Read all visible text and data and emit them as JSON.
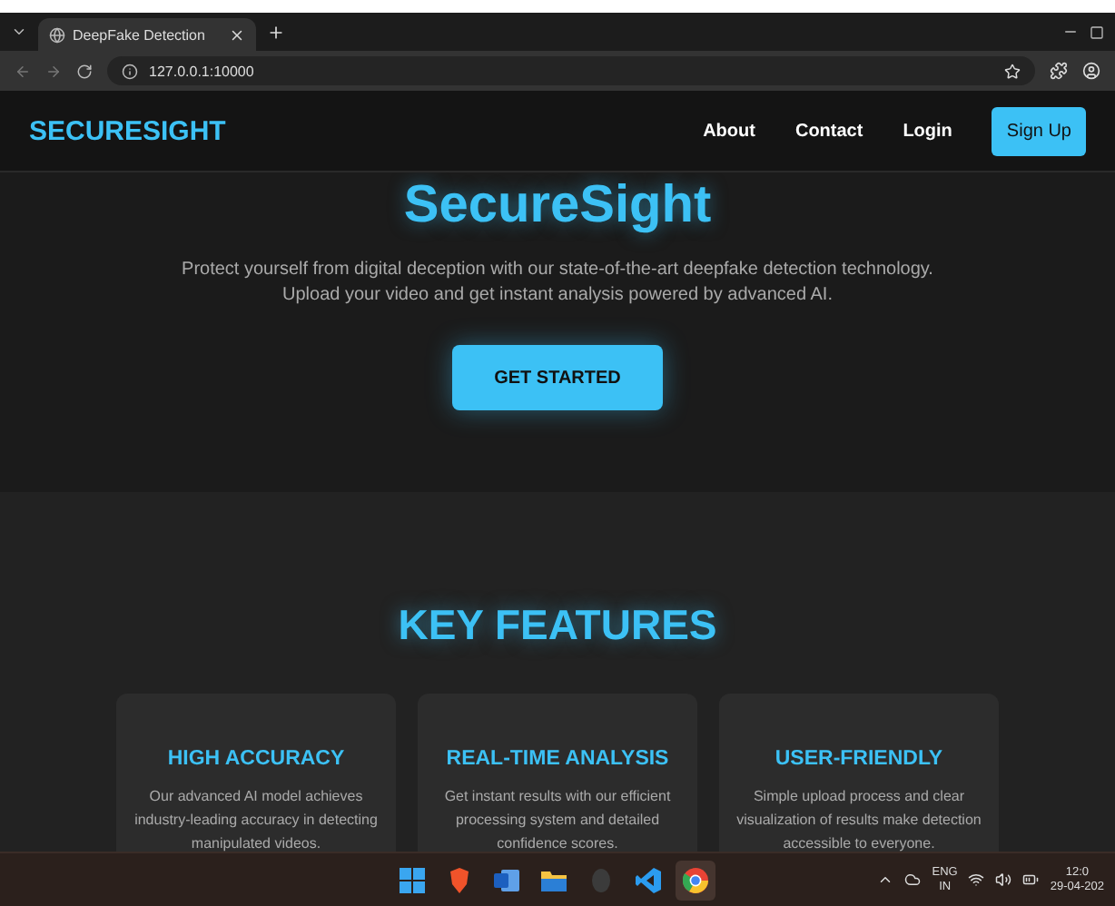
{
  "browser": {
    "tab": {
      "title": "DeepFake Detection",
      "selected": true
    },
    "url": "127.0.0.1:10000"
  },
  "navbar": {
    "brand": "SECURESIGHT",
    "links": [
      "About",
      "Contact",
      "Login"
    ],
    "cta": "Sign Up"
  },
  "hero": {
    "title": "SecureSight",
    "description": "Protect yourself from digital deception with our state-of-the-art deepfake detection technology. Upload your video and get instant analysis powered by advanced AI.",
    "button": "GET STARTED"
  },
  "features": {
    "heading": "KEY FEATURES",
    "cards": [
      {
        "title": "HIGH ACCURACY",
        "text": "Our advanced AI model achieves industry-leading accuracy in detecting manipulated videos."
      },
      {
        "title": "REAL-TIME ANALYSIS",
        "text": "Get instant results with our efficient processing system and detailed confidence scores."
      },
      {
        "title": "USER-FRIENDLY",
        "text": "Simple upload process and clear visualization of results make detection accessible to everyone."
      }
    ]
  },
  "taskbar": {
    "apps": [
      {
        "kind": "grid",
        "selected": false
      },
      {
        "kind": "shield",
        "selected": false
      },
      {
        "kind": "document",
        "selected": false
      },
      {
        "kind": "folder",
        "selected": false
      },
      {
        "kind": "circle",
        "selected": false
      },
      {
        "kind": "ribbon",
        "selected": false
      },
      {
        "kind": "ring",
        "selected": true
      }
    ],
    "language": [
      "ENG",
      "IN"
    ],
    "time": "12:0",
    "date": "29-04-202"
  }
}
